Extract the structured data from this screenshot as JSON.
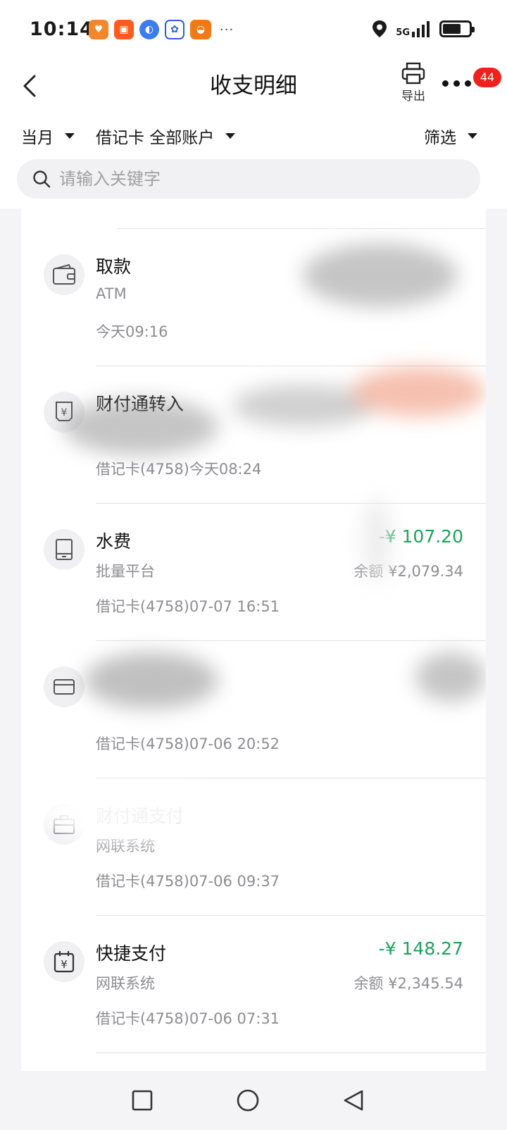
{
  "status_bar": {
    "time": "10:14",
    "network": "5G",
    "more_icons": "···",
    "app_icons": [
      "pinduoduo-icon",
      "kuaishou-icon",
      "browser-icon",
      "baidu-icon",
      "app-icon"
    ],
    "battery_level": 0.7
  },
  "nav": {
    "title": "收支明细",
    "export_label": "导出",
    "badge_count": "44"
  },
  "filters": {
    "period": "当月",
    "account": "借记卡 全部账户",
    "filter_label": "筛选"
  },
  "search": {
    "placeholder": "请输入关键字"
  },
  "transactions": [
    {
      "icon": "wallet-icon",
      "title": "取款",
      "channel": "ATM",
      "amount": "",
      "balance": "",
      "meta": "今天09:16"
    },
    {
      "icon": "receipt-icon",
      "title": "财付通转入",
      "channel": "",
      "amount": "",
      "balance": "",
      "meta": "借记卡(4758)今天08:24"
    },
    {
      "icon": "tablet-icon",
      "title": "水费",
      "channel": "批量平台",
      "amount": "-¥ 107.20",
      "balance": "余额 ¥2,079.34",
      "meta": "借记卡(4758)07-07 16:51"
    },
    {
      "icon": "card-icon",
      "title": "",
      "channel": "",
      "amount": "",
      "balance": "",
      "meta": "借记卡(4758)07-06 20:52"
    },
    {
      "icon": "briefcase-icon",
      "title": "财付通支付",
      "channel": "网联系统",
      "amount": "",
      "balance": "",
      "meta": "借记卡(4758)07-06 09:37"
    },
    {
      "icon": "calendar-yen-icon",
      "title": "快捷支付",
      "channel": "网联系统",
      "amount": "-¥ 148.27",
      "balance": "余额 ¥2,345.54",
      "meta": "借记卡(4758)07-06 07:31"
    }
  ],
  "colors": {
    "expense": "#1aa35b",
    "badge": "#f0211c",
    "secondary_text": "#8d8d92"
  }
}
